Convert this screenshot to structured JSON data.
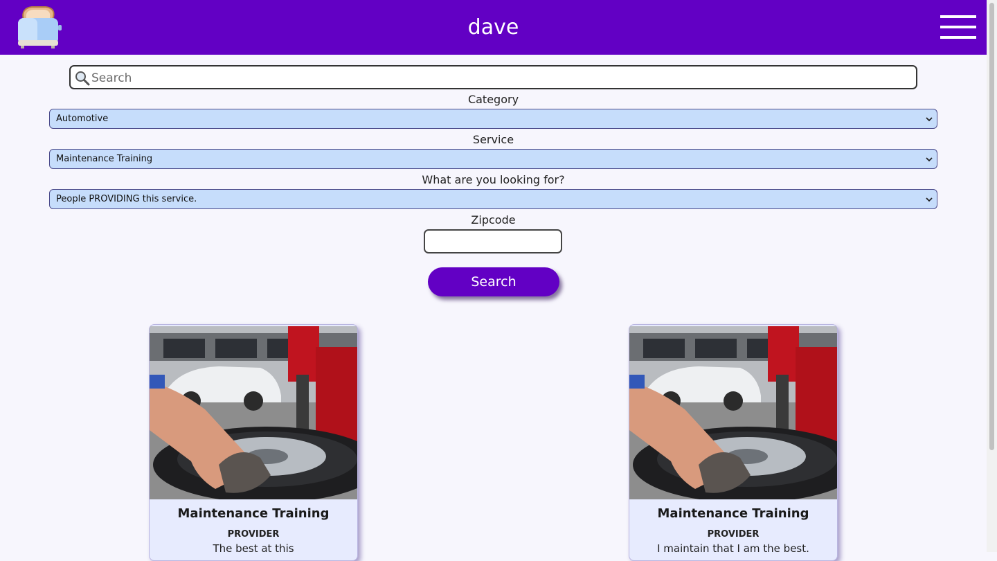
{
  "header": {
    "title": "dave"
  },
  "search": {
    "placeholder": "Search",
    "value": ""
  },
  "filters": {
    "category": {
      "label": "Category",
      "selected": "Automotive"
    },
    "service": {
      "label": "Service",
      "selected": "Maintenance Training"
    },
    "looking_for": {
      "label": "What are you looking for?",
      "selected": "People PROVIDING this service."
    },
    "zipcode": {
      "label": "Zipcode",
      "value": ""
    }
  },
  "search_button": {
    "label": "Search"
  },
  "results": [
    {
      "title": "Maintenance Training",
      "role": "PROVIDER",
      "description": "The best at this"
    },
    {
      "title": "Maintenance Training",
      "role": "PROVIDER",
      "description": "I maintain that I am the best."
    }
  ],
  "colors": {
    "brand": "#6200c4",
    "select_bg": "#c6ddfb",
    "card_bg": "#e7ebfe",
    "page_bg": "#f7f6fd"
  },
  "icons": {
    "logo": "toaster-logo-icon",
    "menu": "hamburger-menu-icon",
    "search": "magnifier-icon",
    "dropdown": "chevron-down-icon"
  }
}
